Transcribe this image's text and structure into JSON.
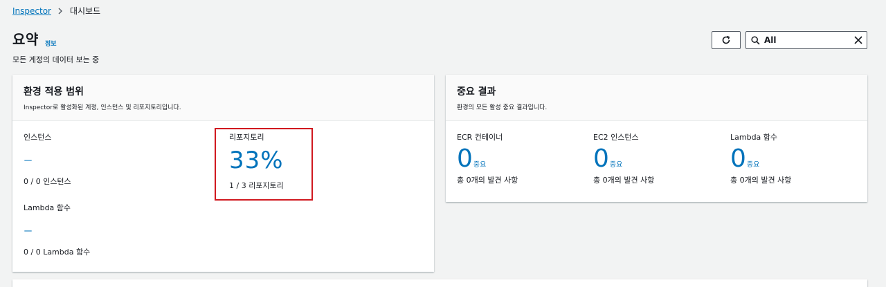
{
  "breadcrumb": {
    "items": [
      {
        "label": "Inspector",
        "link": true
      },
      {
        "label": "대시보드",
        "link": false
      }
    ]
  },
  "header": {
    "title": "요약",
    "info_link": "정보",
    "subtitle": "모든 계정의 데이터 보는 중"
  },
  "toolbar": {
    "filter_value": "All"
  },
  "coverage": {
    "title": "환경 적용 범위",
    "description": "Inspector로 활성화된 계정, 인스턴스 및 리포지토리입니다.",
    "instances": {
      "label": "인스턴스",
      "value": "–",
      "detail": "0 / 0 인스턴스"
    },
    "repositories": {
      "label": "리포지토리",
      "value": "33%",
      "detail": "1 / 3 리포지토리"
    },
    "lambda": {
      "label": "Lambda 함수",
      "value": "–",
      "detail": "0 / 0 Lambda 함수"
    }
  },
  "findings": {
    "title": "중요 결과",
    "description": "환경의 모든 활성 중요 결과입니다.",
    "items": [
      {
        "label": "ECR 컨테이너",
        "count": "0",
        "unit": "중요",
        "detail": "총 0개의 발견 사항"
      },
      {
        "label": "EC2 인스턴스",
        "count": "0",
        "unit": "중요",
        "detail": "총 0개의 발견 사항"
      },
      {
        "label": "Lambda 함수",
        "count": "0",
        "unit": "중요",
        "detail": "총 0개의 발견 사항"
      }
    ]
  },
  "colors": {
    "link": "#0073bb",
    "highlight": "#d0181f",
    "background": "#f2f3f3"
  }
}
